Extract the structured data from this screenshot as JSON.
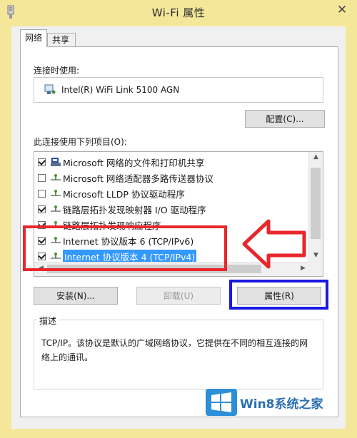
{
  "window": {
    "title": "Wi-Fi 属性",
    "close_glyph": "✕"
  },
  "tabs": [
    {
      "label": "网络",
      "active": true
    },
    {
      "label": "共享",
      "active": false
    }
  ],
  "connect_using": {
    "label": "连接时使用:",
    "adapter": "Intel(R) WiFi Link 5100 AGN",
    "configure_button": "配置(C)..."
  },
  "items": {
    "label": "此连接使用下列项目(O):",
    "list": [
      {
        "text": "Microsoft 网络的文件和打印机共享",
        "checked": true,
        "icon": "printer-share-icon",
        "selected": false
      },
      {
        "text": "Microsoft 网络适配器多路传送器协议",
        "checked": false,
        "icon": "protocol-icon",
        "selected": false
      },
      {
        "text": "Microsoft LLDP 协议驱动程序",
        "checked": false,
        "icon": "protocol-icon",
        "selected": false
      },
      {
        "text": "链路层拓扑发现映射器 I/O 驱动程序",
        "checked": true,
        "icon": "protocol-icon",
        "selected": false
      },
      {
        "text": "链路层拓扑发现响应程序",
        "checked": true,
        "icon": "protocol-icon",
        "selected": false
      },
      {
        "text": "Internet 协议版本 6 (TCP/IPv6)",
        "checked": true,
        "icon": "protocol-icon",
        "selected": false
      },
      {
        "text": "Internet 协议版本 4 (TCP/IPv4)",
        "checked": true,
        "icon": "protocol-icon",
        "selected": true
      }
    ]
  },
  "buttons": {
    "install": "安装(N)...",
    "uninstall": "卸载(U)",
    "properties": "属性(R)"
  },
  "description": {
    "title": "描述",
    "text": "TCP/IP。该协议是默认的广域网络协议，它提供在不同的相互连接的网络上的通讯。"
  },
  "watermark": {
    "text": "Win8系统之家"
  },
  "colors": {
    "frame": "#f4e79a",
    "selection": "#3399ff",
    "annotation_red": "#e8262b",
    "annotation_blue": "#1a1ae0"
  }
}
